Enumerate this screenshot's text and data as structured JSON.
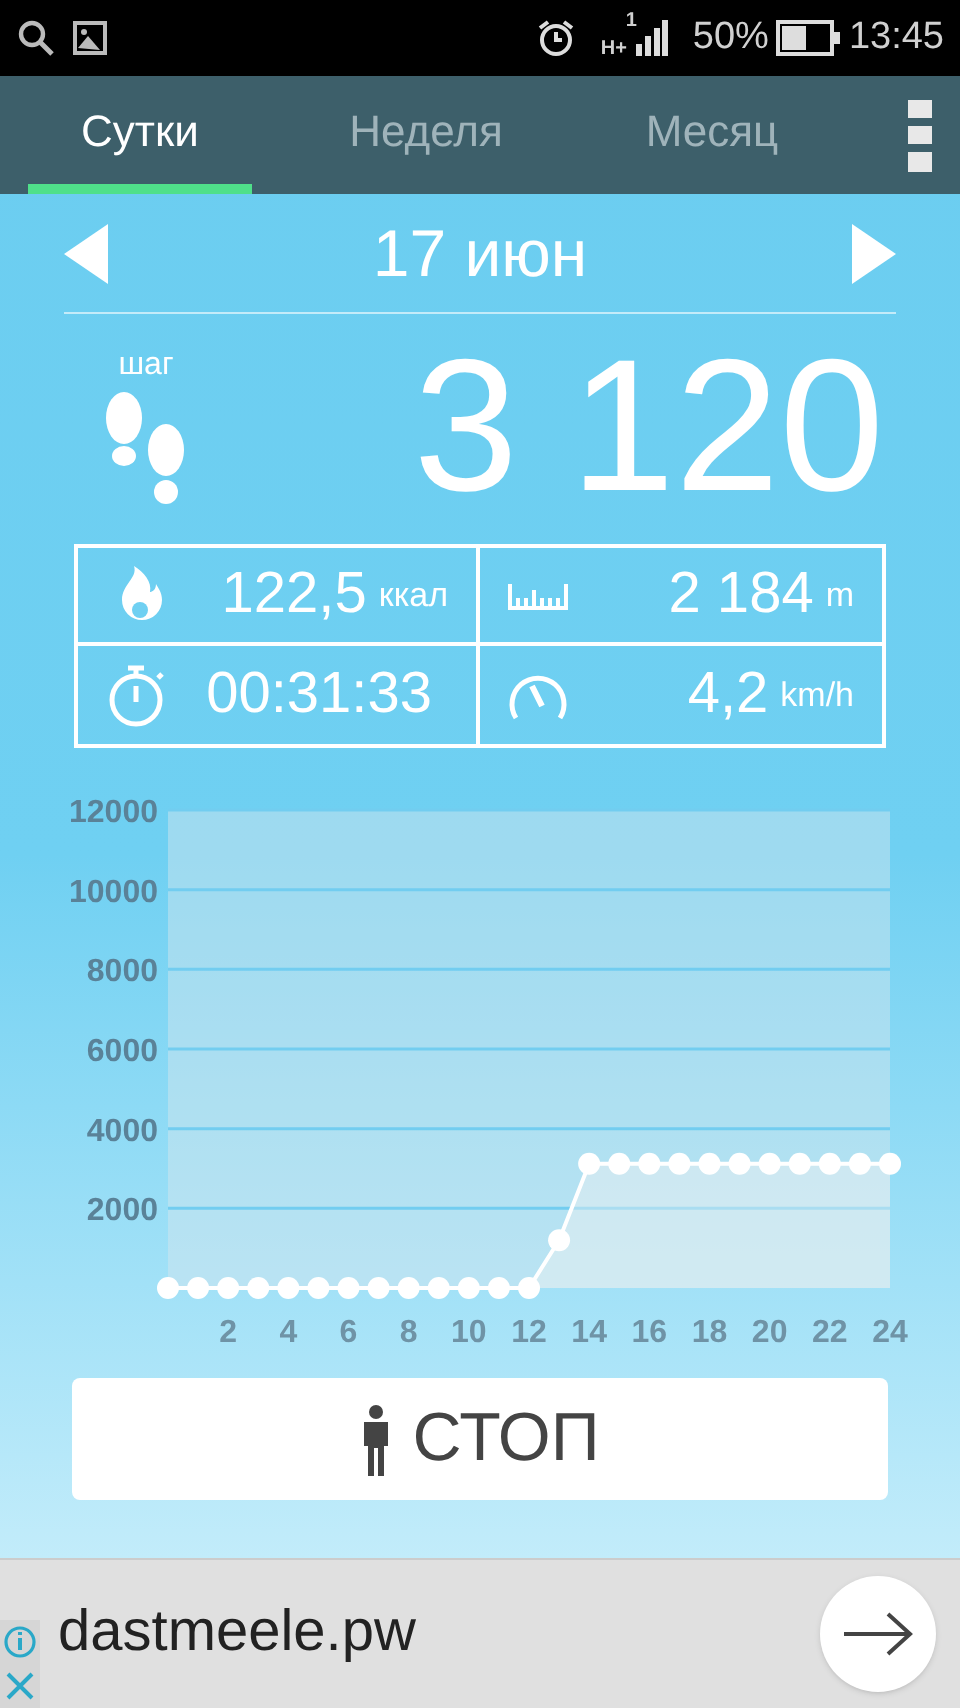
{
  "status_bar": {
    "network": "H+",
    "sim": "1",
    "battery": "50%",
    "time": "13:45"
  },
  "tabs": [
    {
      "label": "Сутки",
      "selected": true
    },
    {
      "label": "Неделя",
      "selected": false
    },
    {
      "label": "Месяц",
      "selected": false
    }
  ],
  "date": "17 июн",
  "steps": {
    "label": "шаг",
    "value": "3 120"
  },
  "stats": [
    {
      "kind": "calories",
      "value": "122,5",
      "unit": "ккал"
    },
    {
      "kind": "distance",
      "value": "2 184",
      "unit": "m"
    },
    {
      "kind": "time",
      "value": "00:31:33"
    },
    {
      "kind": "speed",
      "value": "4,2",
      "unit": "km/h"
    }
  ],
  "chart_data": {
    "type": "area",
    "x": [
      0,
      1,
      2,
      3,
      4,
      5,
      6,
      7,
      8,
      9,
      10,
      11,
      12,
      13,
      14,
      15,
      16,
      17,
      18,
      19,
      20,
      21,
      22,
      23,
      24
    ],
    "grid": true,
    "series": [
      {
        "color": "#ffffff",
        "values": [
          0,
          0,
          0,
          0,
          0,
          0,
          0,
          0,
          0,
          0,
          0,
          0,
          0,
          1200,
          3120,
          3120,
          3120,
          3120,
          3120,
          3120,
          3120,
          3120,
          3120,
          3120,
          3120
        ]
      }
    ],
    "xlim": [
      0,
      24
    ],
    "ylim": [
      0,
      12000
    ],
    "xticks": [
      2,
      4,
      6,
      8,
      10,
      12,
      14,
      16,
      18,
      20,
      22,
      24
    ],
    "yticks": [
      2000,
      4000,
      6000,
      8000,
      10000,
      12000
    ]
  },
  "stop_button": {
    "label": "СТОП"
  },
  "ad": {
    "text": "dastmeele.pw"
  }
}
